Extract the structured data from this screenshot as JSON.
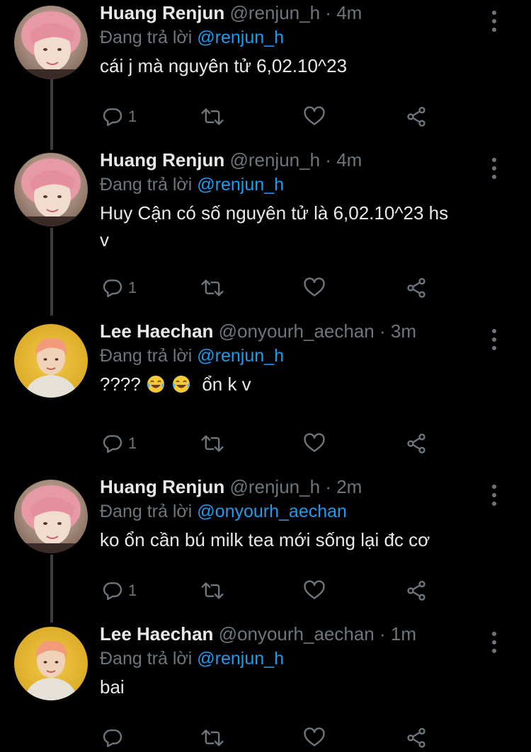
{
  "tweets": [
    {
      "name": "Huang Renjun",
      "handle": "@renjun_h",
      "sep": "·",
      "time": "4m",
      "reply_prefix": "Đang trả lời",
      "reply_to": "@renjun_h",
      "text": "cái j mà nguyên tử 6,02.10^23",
      "reply_count": "1"
    },
    {
      "name": "Huang Renjun",
      "handle": "@renjun_h",
      "sep": "·",
      "time": "4m",
      "reply_prefix": "Đang trả lời",
      "reply_to": "@renjun_h",
      "text": "Huy Cận có số nguyên tử là 6,02.10^23 hs\nv",
      "reply_count": "1"
    },
    {
      "name": "Lee Haechan",
      "handle": "@onyourh_aechan",
      "sep": "·",
      "time": "3m",
      "reply_prefix": "Đang trả lời",
      "reply_to": "@renjun_h",
      "text_prefix": "????",
      "emojis": [
        "face-with-tears-of-joy",
        "face-with-tears-of-joy"
      ],
      "text": "ổn k v",
      "reply_count": "1"
    },
    {
      "name": "Huang Renjun",
      "handle": "@renjun_h",
      "sep": "·",
      "time": "2m",
      "reply_prefix": "Đang trả lời",
      "reply_to": "@onyourh_aechan",
      "text": "ko ổn cần bú milk tea mới sống lại đc cơ",
      "reply_count": "1"
    },
    {
      "name": "Lee Haechan",
      "handle": "@onyourh_aechan",
      "sep": "·",
      "time": "1m",
      "reply_prefix": "Đang trả lời",
      "reply_to": "@renjun_h",
      "text": "bai",
      "reply_count": ""
    }
  ],
  "colors": {
    "background": "#000000",
    "text": "#e7e9ea",
    "muted": "#6e767d",
    "link": "#1d9bf0",
    "thread_line": "#3a3d40"
  },
  "icons": [
    "reply-icon",
    "retweet-icon",
    "like-icon",
    "share-icon",
    "more-options-icon"
  ]
}
